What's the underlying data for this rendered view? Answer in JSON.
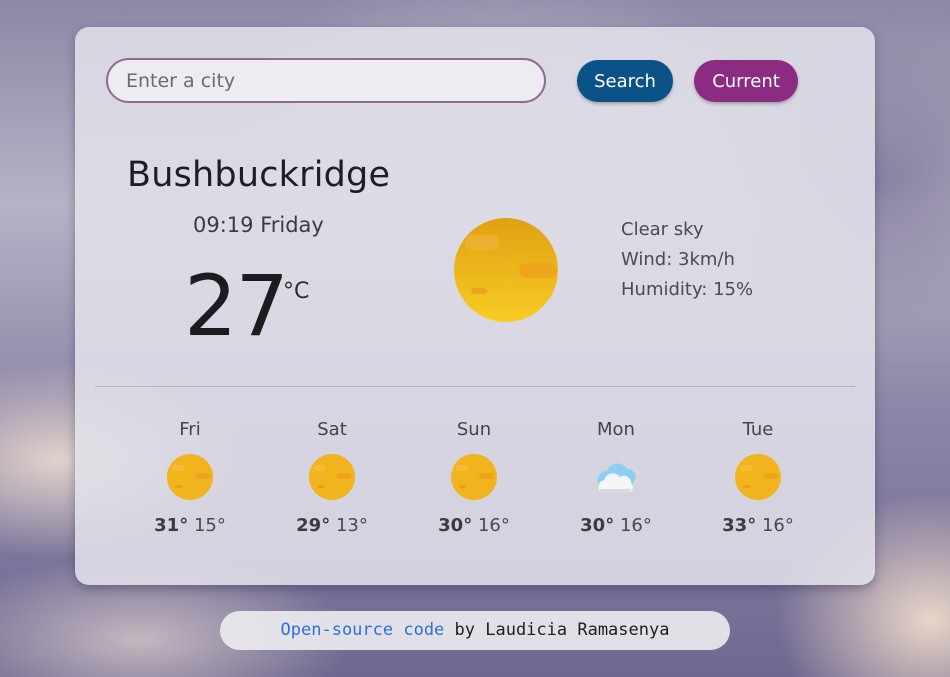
{
  "search": {
    "placeholder": "Enter a city",
    "value": "",
    "search_label": "Search",
    "current_label": "Current"
  },
  "current": {
    "city": "Bushbuckridge",
    "time": "09:19",
    "weekday": "Friday",
    "datetime": "09:19 Friday",
    "temperature": "27",
    "unit": "°C",
    "icon": "clear-sky-sun-icon",
    "description": "Clear sky",
    "wind": "Wind: 3km/h",
    "humidity": "Humidity: 15%"
  },
  "forecast": [
    {
      "day": "Fri",
      "icon": "sun-icon",
      "high": "31°",
      "low": "15°"
    },
    {
      "day": "Sat",
      "icon": "sun-icon",
      "high": "29°",
      "low": "13°"
    },
    {
      "day": "Sun",
      "icon": "sun-icon",
      "high": "30°",
      "low": "16°"
    },
    {
      "day": "Mon",
      "icon": "cloud-icon",
      "high": "30°",
      "low": "16°"
    },
    {
      "day": "Tue",
      "icon": "sun-icon",
      "high": "33°",
      "low": "16°"
    }
  ],
  "footer": {
    "link_text": "Open-source code",
    "suffix": " by Laudicia Ramasenya"
  },
  "colors": {
    "search_button": "#0b5287",
    "current_button": "#8b2b82",
    "link": "#2d6fd6",
    "sun": "#f2b51e"
  }
}
